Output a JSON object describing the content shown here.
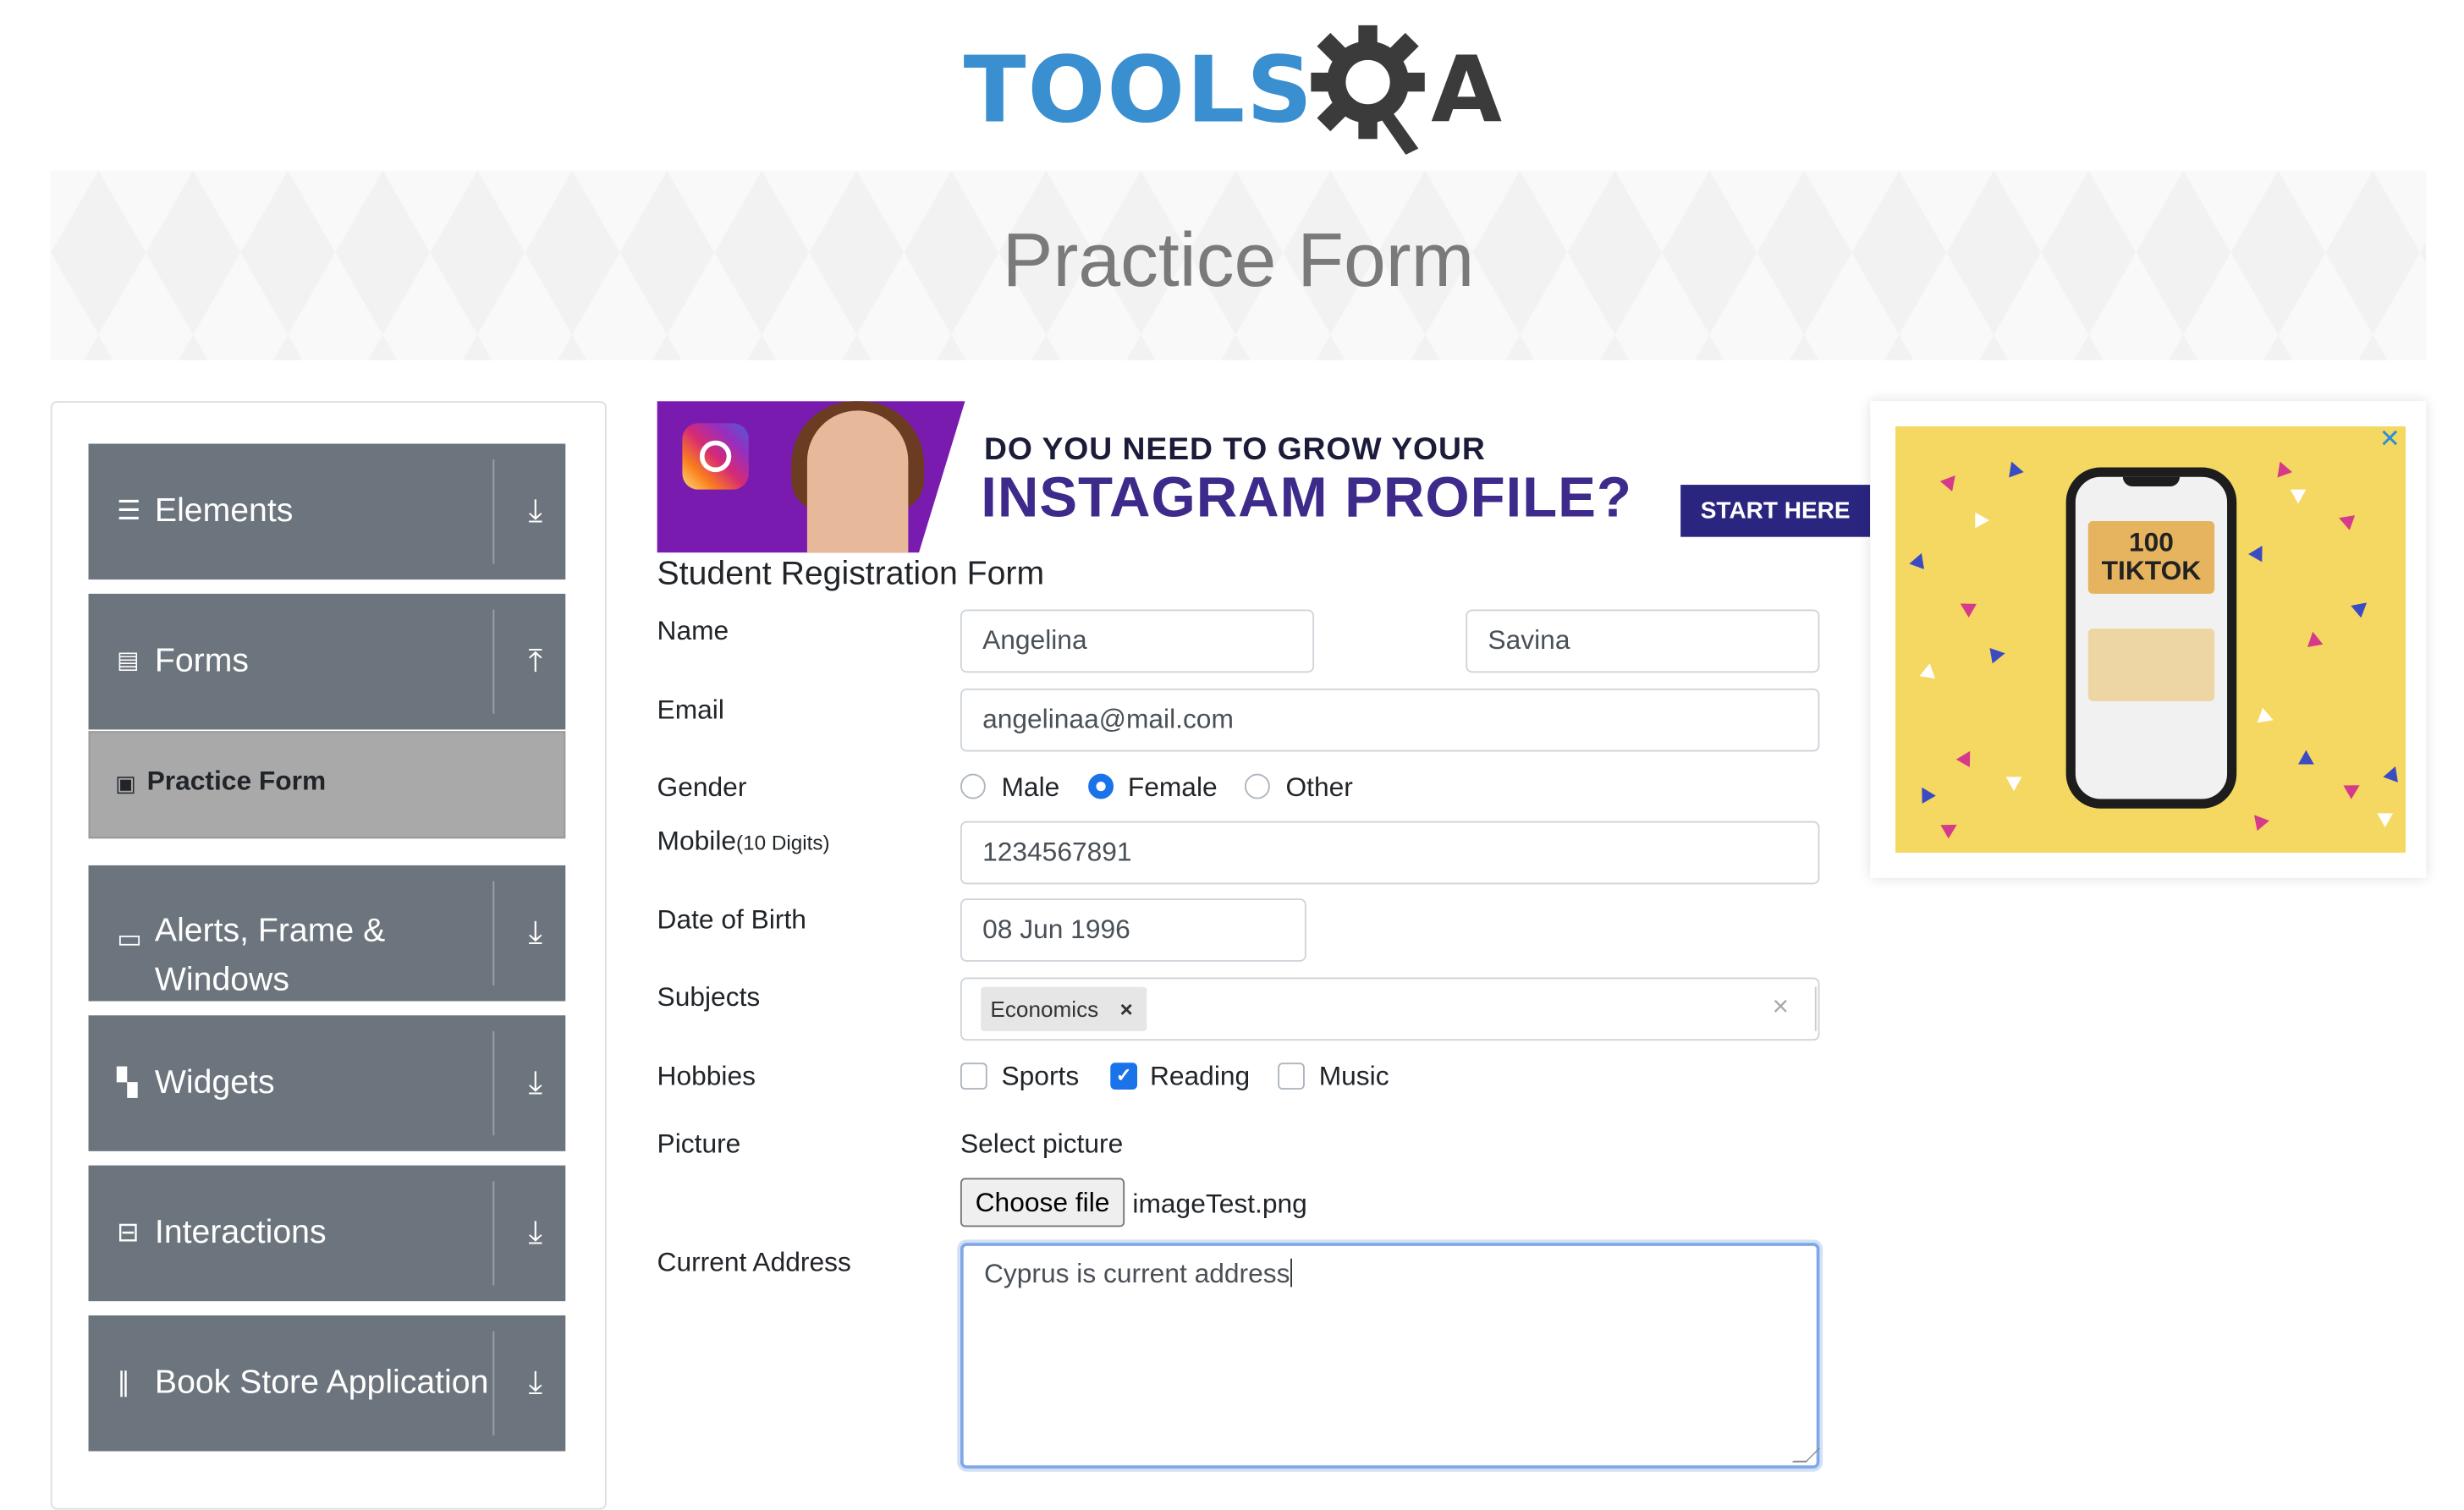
{
  "logo": {
    "text_part": "TOOLS",
    "qa_part": "QA"
  },
  "banner": {
    "title": "Practice Form"
  },
  "sidebar": {
    "items": [
      {
        "label": "Elements",
        "icon": "hamburger-icon",
        "arrow": "download-icon"
      },
      {
        "label": "Forms",
        "icon": "document-icon",
        "arrow": "upload-icon"
      },
      {
        "label": "Alerts, Frame & Windows",
        "icon": "window-icon",
        "arrow": "download-icon"
      },
      {
        "label": "Widgets",
        "icon": "widgets-icon",
        "arrow": "download-icon"
      },
      {
        "label": "Interactions",
        "icon": "interactions-icon",
        "arrow": "download-icon"
      },
      {
        "label": "Book Store Application",
        "icon": "bookshelf-icon",
        "arrow": "download-icon"
      }
    ],
    "subitem": {
      "label": "Practice Form",
      "icon": "form-icon"
    }
  },
  "ad_top": {
    "line1": "DO YOU NEED TO GROW YOUR",
    "line2": "INSTAGRAM PROFILE?",
    "cta": "START HERE"
  },
  "form": {
    "title": "Student Registration Form",
    "labels": {
      "name": "Name",
      "email": "Email",
      "gender": "Gender",
      "mobile": "Mobile",
      "mobile_hint": "(10 Digits)",
      "dob": "Date of Birth",
      "subjects": "Subjects",
      "hobbies": "Hobbies",
      "picture": "Picture",
      "address": "Current Address"
    },
    "first_name": "Angelina",
    "last_name": "Savina",
    "email": "angelinaa@mail.com",
    "gender_options": [
      "Male",
      "Female",
      "Other"
    ],
    "gender_selected": "Female",
    "mobile": "1234567891",
    "dob": "08 Jun 1996",
    "subjects": [
      "Economics"
    ],
    "subject_remove": "×",
    "clear_glyph": "×",
    "hobby_options": [
      "Sports",
      "Reading",
      "Music"
    ],
    "hobbies_checked": [
      "Reading"
    ],
    "picture_prompt": "Select picture",
    "choose_file": "Choose file",
    "file_name": "imageTest.png",
    "current_address": "Cyprus is current address"
  },
  "ad_right": {
    "phone_text": "100 TIKTOK",
    "close": "✕"
  },
  "colors": {
    "sidebar_bg": "#6c757d",
    "subitem_bg": "#a9a9a9",
    "accent": "#1a73e8",
    "logo_blue": "#3a8fd0",
    "logo_dark": "#3b3b3b"
  }
}
